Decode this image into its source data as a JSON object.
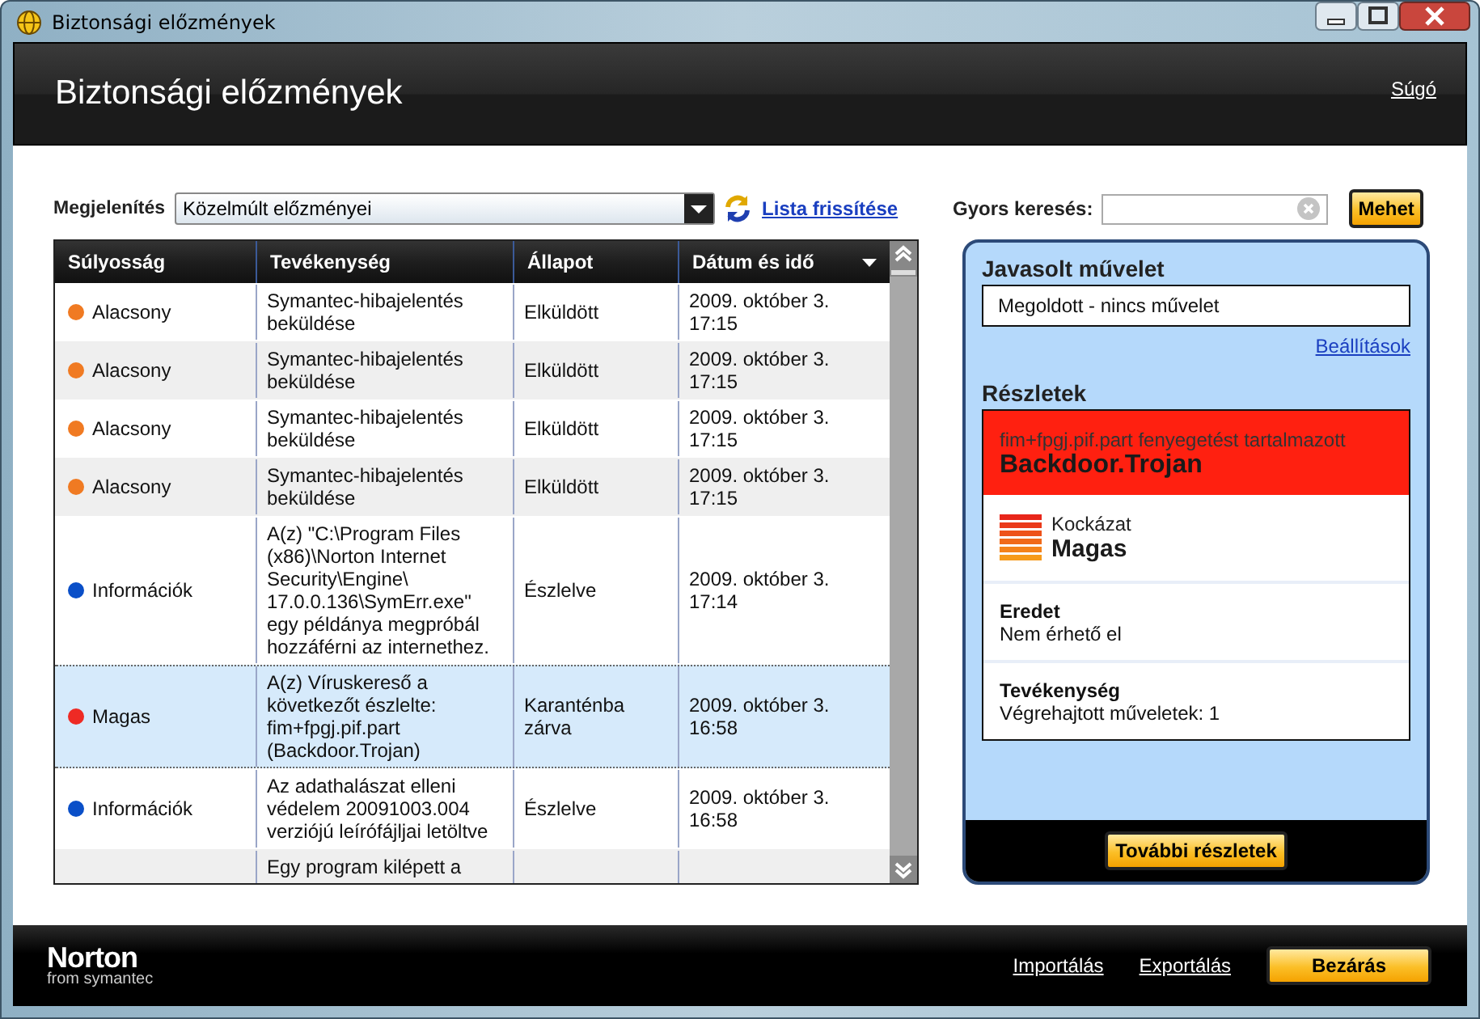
{
  "window": {
    "title": "Biztonsági előzmények"
  },
  "header": {
    "title": "Biztonsági előzmények",
    "help_link": "Súgó"
  },
  "view": {
    "label": "Megjelenítés",
    "value": "Közelmúlt előzményei",
    "refresh_link": "Lista frissítése"
  },
  "table": {
    "columns": [
      {
        "label": "Súlyosság",
        "sorted": false
      },
      {
        "label": "Tevékenység",
        "sorted": false
      },
      {
        "label": "Állapot",
        "sorted": false
      },
      {
        "label": "Dátum és idő",
        "sorted": true
      }
    ],
    "rows": [
      {
        "severity": "Alacsony",
        "color": "#f07a22",
        "activity": "Symantec-hibajelentés beküldése",
        "status": "Elküldött",
        "date": "2009. október 3.",
        "time": "17:15",
        "selected": false
      },
      {
        "severity": "Alacsony",
        "color": "#f07a22",
        "activity": "Symantec-hibajelentés beküldése",
        "status": "Elküldött",
        "date": "2009. október 3.",
        "time": "17:15",
        "selected": false
      },
      {
        "severity": "Alacsony",
        "color": "#f07a22",
        "activity": "Symantec-hibajelentés beküldése",
        "status": "Elküldött",
        "date": "2009. október 3.",
        "time": "17:15",
        "selected": false
      },
      {
        "severity": "Alacsony",
        "color": "#f07a22",
        "activity": "Symantec-hibajelentés beküldése",
        "status": "Elküldött",
        "date": "2009. október 3.",
        "time": "17:15",
        "selected": false
      },
      {
        "severity": "Információk",
        "color": "#0a4fc8",
        "activity": "A(z) \"C:\\Program Files (x86)\\Norton Internet Security\\Engine\\ 17.0.0.136\\SymErr.exe\" egy példánya megpróbál hozzáférni az internethez.",
        "status": "Észlelve",
        "date": "2009. október 3.",
        "time": "17:14",
        "selected": false
      },
      {
        "severity": "Magas",
        "color": "#ee2a24",
        "activity": "A(z) Víruskereső a következőt észlelte: fim+fpgj.pif.part (Backdoor.Trojan)",
        "status": "Karanténba zárva",
        "date": "2009. október 3.",
        "time": "16:58",
        "selected": true
      },
      {
        "severity": "Információk",
        "color": "#0a4fc8",
        "activity": "Az adathalászat elleni védelem 20091003.004 verziójú leírófájljai letöltve",
        "status": "Észlelve",
        "date": "2009. október 3.",
        "time": "16:58",
        "selected": false
      },
      {
        "activity": "Egy program kilépett a",
        "selected": false
      }
    ]
  },
  "search": {
    "label": "Gyors keresés:",
    "button": "Mehet"
  },
  "details": {
    "action_heading": "Javasolt művelet",
    "action": "Megoldott - nincs művelet",
    "settings_link": "Beállítások",
    "details_heading": "Részletek",
    "threat_text": "fim+fpgj.pif.part fenyegetést tartalmazott",
    "threat_name": "Backdoor.Trojan",
    "risk_label": "Kockázat",
    "risk_value": "Magas",
    "sections": [
      {
        "label": "Eredet",
        "value": "Nem érhető el"
      },
      {
        "label": "Tevékenység",
        "value": "Végrehajtott műveletek: 1"
      }
    ],
    "more_button": "További részletek"
  },
  "footer": {
    "logo": "Norton",
    "logo_sub": "from symantec",
    "links": [
      "Importálás",
      "Exportálás"
    ],
    "close_button": "Bezárás"
  }
}
